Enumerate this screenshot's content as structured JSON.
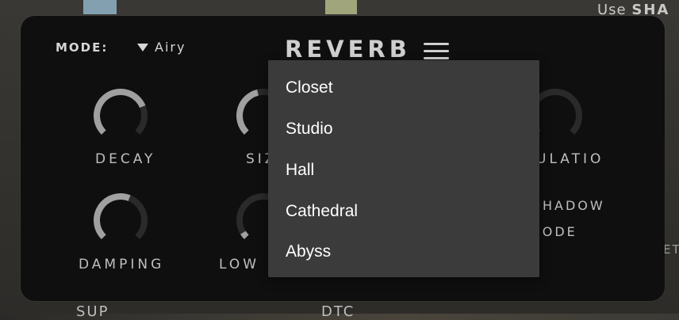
{
  "background": {
    "use_prefix": "Use",
    "use_suffix": "SHA",
    "bottom_left": "SUP",
    "bottom_mid": "DTC",
    "right_edge": "ET"
  },
  "header": {
    "mode_label": "MODE:",
    "mode_value": "Airy",
    "title": "REVERB"
  },
  "knobs": {
    "decay": {
      "label": "DECAY",
      "level": 0.75
    },
    "size": {
      "label": "SIZ",
      "level": 0.45
    },
    "modulation": {
      "label": "ULATIO",
      "level": 0.0
    },
    "damping": {
      "label": "DAMPING",
      "level": 0.58
    },
    "low": {
      "label": "LOW",
      "level": 0.05
    },
    "shadow_mode": {
      "label_line1": "HADOW",
      "label_line2": "IODE"
    }
  },
  "dropdown": {
    "items": [
      "Closet",
      "Studio",
      "Hall",
      "Cathedral",
      "Abyss"
    ]
  },
  "colors": {
    "panel": "#0f0f0f",
    "arc_active": "#a0a0a0",
    "arc_track": "#2a2a2a",
    "menu_bg": "#3b3b3b",
    "menu_text": "#ffffff"
  }
}
